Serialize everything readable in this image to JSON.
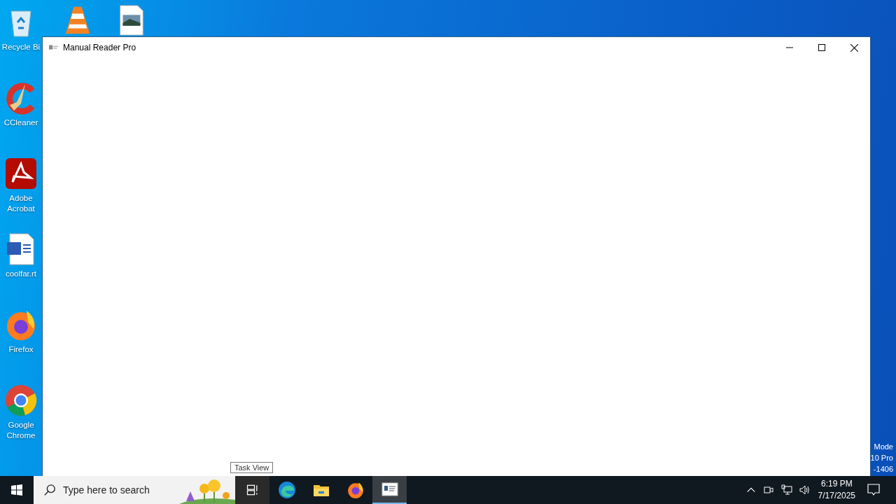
{
  "desktop": {
    "icons": [
      {
        "kind": "recycle-bin",
        "label": "Recycle Bi"
      },
      {
        "kind": "ccleaner",
        "label": "CCleaner"
      },
      {
        "kind": "acrobat",
        "label": "Adobe Acrobat"
      },
      {
        "kind": "word",
        "label": "coolfar.rt"
      },
      {
        "kind": "firefox",
        "label": "Firefox"
      },
      {
        "kind": "chrome",
        "label": "Google Chrome"
      }
    ],
    "top_icons": [
      {
        "kind": "vlc"
      },
      {
        "kind": "image-file"
      }
    ],
    "notice": [
      "Mode",
      "10 Pro",
      "-1406"
    ]
  },
  "window": {
    "title": "Manual Reader Pro"
  },
  "tooltip": "Task View",
  "taskbar": {
    "search": {
      "placeholder": "Type here to search"
    },
    "apps": [
      {
        "kind": "task-view",
        "selected": false
      },
      {
        "kind": "edge",
        "selected": false
      },
      {
        "kind": "explorer",
        "selected": false
      },
      {
        "kind": "firefox",
        "selected": false
      },
      {
        "kind": "app",
        "selected": true
      }
    ],
    "tray": {
      "time": "6:19 PM",
      "date": "7/17/2025"
    }
  }
}
